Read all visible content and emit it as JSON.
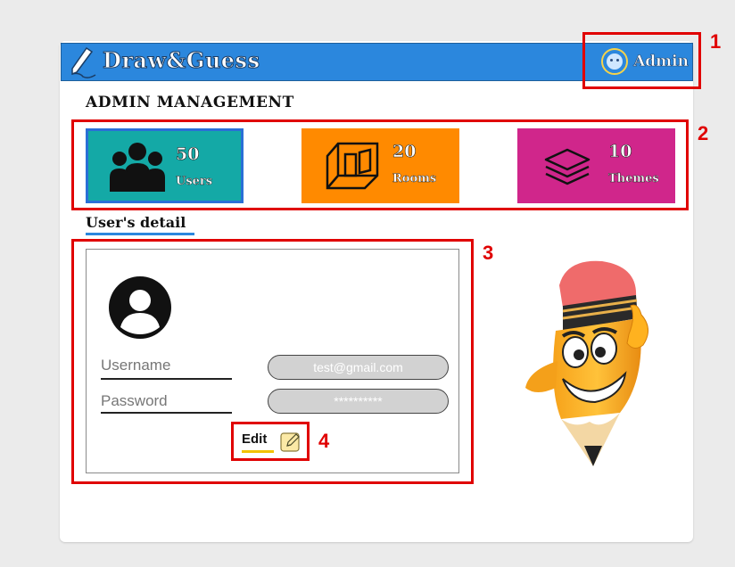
{
  "app": {
    "title": "Draw&Guess"
  },
  "header": {
    "user_label": "Admin"
  },
  "page": {
    "section_title": "ADMIN MANAGEMENT"
  },
  "stats": [
    {
      "value": "50",
      "label": "Users",
      "icon": "users-icon",
      "color": "#14a9a6"
    },
    {
      "value": "20",
      "label": "Rooms",
      "icon": "room-cube-icon",
      "color": "#ff8a00"
    },
    {
      "value": "10",
      "label": "Themes",
      "icon": "layers-icon",
      "color": "#d0268b"
    }
  ],
  "user_detail": {
    "title": "User's detail",
    "username_label": "Username",
    "username_value": "test@gmail.com",
    "password_label": "Password",
    "password_value": "**********",
    "edit_label": "Edit"
  },
  "annotations": [
    "1",
    "2",
    "3",
    "4"
  ],
  "colors": {
    "brand_blue": "#2b87dd",
    "annotation_red": "#e00000"
  }
}
